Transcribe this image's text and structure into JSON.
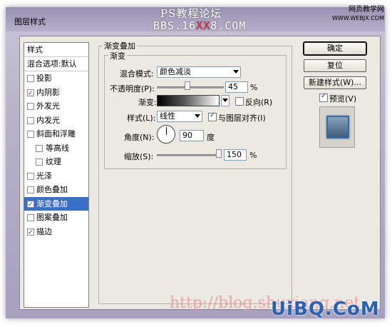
{
  "window": {
    "title": "图层样式"
  },
  "watermarks": {
    "line1": "PS教程论坛",
    "line2_prefix": "BBS.16",
    "line2_red": "XX",
    "line2_suffix": "8.COM",
    "site_line1": "网页教学网",
    "site_line2": "WWW.WEBJX.COM",
    "bottom_url": "http://blog.shuxiang.net",
    "bottom_logo": "UiBQ.CoM"
  },
  "style_list": {
    "header": "样式",
    "blend_default": "混合选项:默认",
    "items": [
      {
        "label": "投影",
        "checked": false,
        "indent": false
      },
      {
        "label": "内阴影",
        "checked": true,
        "indent": false
      },
      {
        "label": "外发光",
        "checked": false,
        "indent": false
      },
      {
        "label": "内发光",
        "checked": false,
        "indent": false
      },
      {
        "label": "斜面和浮雕",
        "checked": false,
        "indent": false
      },
      {
        "label": "等高线",
        "checked": false,
        "indent": true
      },
      {
        "label": "纹理",
        "checked": false,
        "indent": true
      },
      {
        "label": "光泽",
        "checked": false,
        "indent": false
      },
      {
        "label": "颜色叠加",
        "checked": false,
        "indent": false
      },
      {
        "label": "渐变叠加",
        "checked": true,
        "indent": false,
        "selected": true
      },
      {
        "label": "图案叠加",
        "checked": false,
        "indent": false
      },
      {
        "label": "描边",
        "checked": true,
        "indent": false
      }
    ]
  },
  "panel": {
    "outer_title": "渐变叠加",
    "inner_title": "渐变",
    "blend_mode_label": "混合模式:",
    "blend_mode_value": "颜色减淡",
    "opacity_label": "不透明度(P):",
    "opacity_value": "45",
    "opacity_unit": "%",
    "opacity_level": 0.45,
    "gradient_label": "渐变:",
    "reverse_label": "反向(R)",
    "reverse_checked": false,
    "style_label": "样式(L):",
    "style_value": "线性",
    "align_label": "与图层对齐(I)",
    "align_checked": true,
    "angle_label": "角度(N):",
    "angle_value": "90",
    "angle_unit": "度",
    "scale_label": "缩放(S):",
    "scale_value": "150",
    "scale_unit": "%",
    "scale_level": 1.0
  },
  "buttons": {
    "ok": "确定",
    "reset": "复位",
    "new_style": "新建样式(W)...",
    "preview_label": "预览(V)",
    "preview_checked": true
  }
}
